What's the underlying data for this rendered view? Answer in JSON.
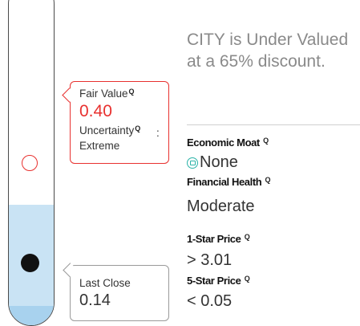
{
  "thermometer": {
    "fair_value_marker": "open-red-circle",
    "last_close_marker": "filled-black-circle",
    "colors": {
      "fill": "#c9e3f4",
      "band": "#a8d2ee",
      "fair_value": "#e8312f",
      "last_close": "#111111"
    }
  },
  "fair_value_box": {
    "label": "Fair Value",
    "value": "0.40",
    "uncertainty_label": "Uncertainty",
    "colon": ":",
    "uncertainty_value": "Extreme",
    "info_icon_glyph": "Q"
  },
  "last_close_box": {
    "label": "Last Close",
    "value": "0.14"
  },
  "headline": "CITY is Under Valued at a 65% discount.",
  "metrics": {
    "moat_label": "Economic Moat",
    "moat_value": "None",
    "moat_icon": "moat-none-icon",
    "health_label": "Financial Health",
    "health_value": "Moderate",
    "one_star_label": "1-Star Price",
    "one_star_value": "> 3.01",
    "five_star_label": "5-Star Price",
    "five_star_value": "< 0.05",
    "info_icon_glyph": "Q"
  }
}
